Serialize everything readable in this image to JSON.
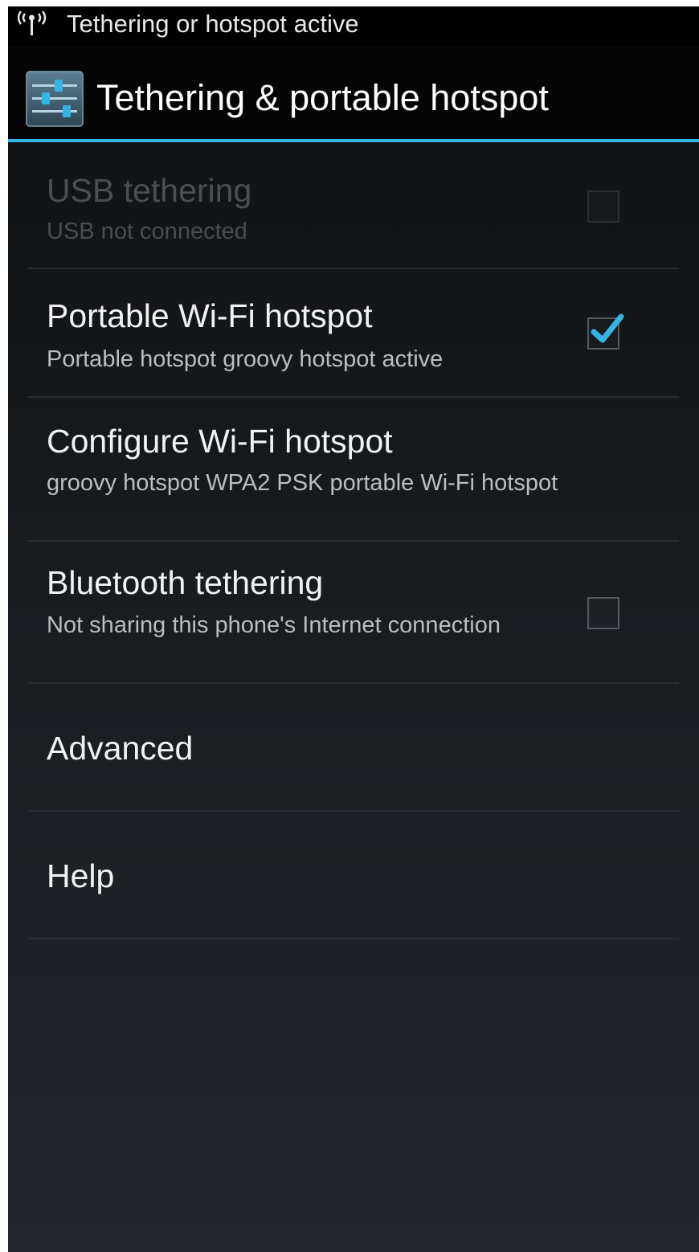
{
  "status_bar": {
    "icon": "tethering-icon",
    "text": "Tethering or hotspot active"
  },
  "action_bar": {
    "icon": "settings-sliders-icon",
    "title": "Tethering & portable hotspot",
    "accent_color": "#33b5e5"
  },
  "preferences": [
    {
      "title": "USB tethering",
      "summary": "USB not connected",
      "has_checkbox": true,
      "checked": false,
      "enabled": false
    },
    {
      "title": "Portable Wi-Fi hotspot",
      "summary": "Portable hotspot groovy hotspot active",
      "has_checkbox": true,
      "checked": true,
      "enabled": true
    },
    {
      "title": "Configure Wi-Fi hotspot",
      "summary": "groovy hotspot WPA2 PSK portable Wi-Fi hotspot",
      "has_checkbox": false,
      "enabled": true
    },
    {
      "title": "Bluetooth tethering",
      "summary": "Not sharing this phone's Internet connection",
      "has_checkbox": true,
      "checked": false,
      "enabled": true
    },
    {
      "title": "Advanced",
      "summary": "",
      "has_checkbox": false,
      "enabled": true
    },
    {
      "title": "Help",
      "summary": "",
      "has_checkbox": false,
      "enabled": true
    }
  ],
  "colors": {
    "check_mark": "#33b5e5"
  }
}
